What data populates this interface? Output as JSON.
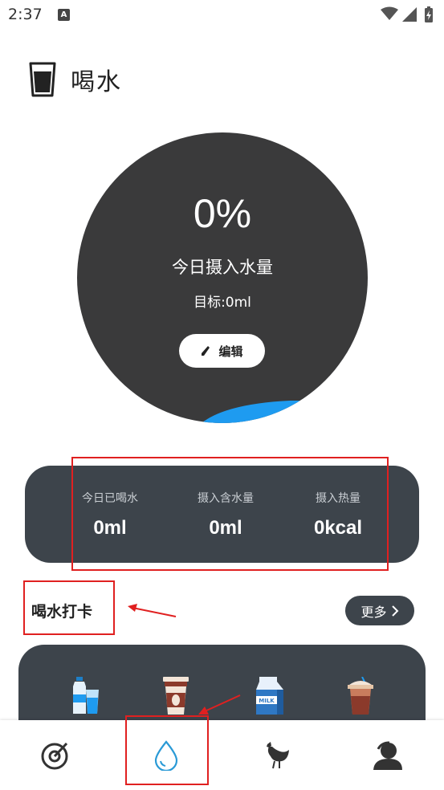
{
  "status_bar": {
    "time": "2:37",
    "notification_letter": "A"
  },
  "header": {
    "title": "喝水"
  },
  "progress": {
    "percent_text": "0%",
    "percent": 0,
    "label": "今日摄入水量",
    "goal_text": "目标:0ml",
    "edit_label": "编辑"
  },
  "stats": [
    {
      "label": "今日已喝水",
      "value": "0ml"
    },
    {
      "label": "摄入含水量",
      "value": "0ml"
    },
    {
      "label": "摄入热量",
      "value": "0kcal"
    }
  ],
  "checkin": {
    "title": "喝水打卡",
    "more_label": "更多",
    "drinks": [
      "water-bottle-icon",
      "coffee-cup-icon",
      "milk-carton-icon",
      "iced-drink-icon"
    ]
  },
  "bottom_nav": {
    "items": [
      "dashboard-icon",
      "water-drop-icon",
      "chicken-icon",
      "profile-icon"
    ],
    "active_index": 1
  },
  "colors": {
    "circle": "#3a3a3b",
    "card": "#3d444b",
    "water": "#1e9bf0",
    "active_nav": "#2a9ad6",
    "annotation": "#e02020"
  }
}
